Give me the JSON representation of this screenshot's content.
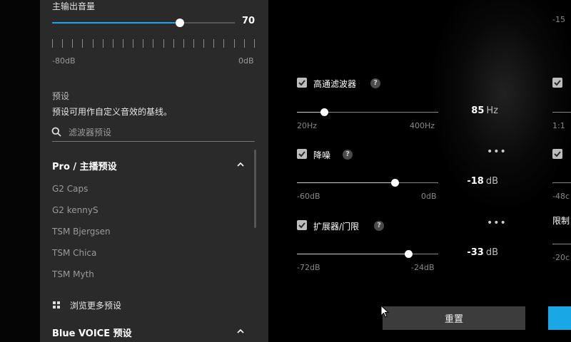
{
  "sidebar": {
    "volume": {
      "label": "主输出音量",
      "value": 70,
      "min_label": "-80dB",
      "max_label": "0dB"
    },
    "presets": {
      "heading": "预设",
      "description": "预设可用作自定义音效的基线。",
      "search_placeholder": "滤波器预设",
      "group_title": "Pro / 主播预设",
      "items": [
        "G2 Caps",
        "G2 kennyS",
        "TSM Bjergsen",
        "TSM Chica",
        "TSM Myth"
      ],
      "browse_label": "浏览更多预设",
      "group2_title": "Blue VOICE 预设"
    }
  },
  "main": {
    "high_pass": {
      "label": "高通滤波器",
      "value": "85",
      "unit": "Hz",
      "min": "20Hz",
      "max": "400Hz",
      "fraction": 0.19
    },
    "noise_reduction": {
      "label": "降噪",
      "value": "-18",
      "unit": "dB",
      "min": "-60dB",
      "max": "0dB",
      "fraction": 0.69
    },
    "expander": {
      "label": "扩展器/门限",
      "value": "-33",
      "unit": "dB",
      "min": "-72dB",
      "max": "-24dB",
      "fraction": 0.79
    },
    "reset_label": "重置",
    "right_col": {
      "top": "-15",
      "ratio": "1:1",
      "min": "-48c",
      "label": "限制",
      "min2": "-20c"
    }
  },
  "colors": {
    "accent": "#1aa7e6",
    "sidebar_bg": "#2a2a2a"
  }
}
